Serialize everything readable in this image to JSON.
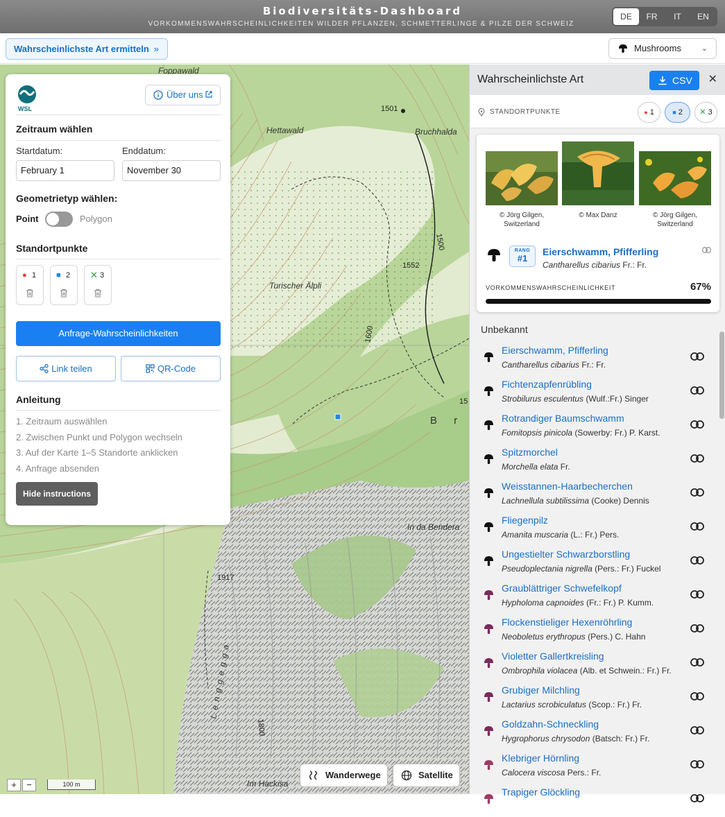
{
  "header": {
    "title": "Biodiversitäts-Dashboard",
    "subtitle": "VORKOMMENSWAHRSCHEINLICHKEITEN WILDER PFLANZEN, SCHMETTERLINGE & PILZE DER SCHWEIZ",
    "languages": [
      "DE",
      "FR",
      "IT",
      "EN"
    ],
    "active_language": "DE"
  },
  "toolbar": {
    "find_species_label": "Wahrscheinlichste Art ermitteln",
    "taxon_select_value": "Mushrooms",
    "taxon_icon": "mushroom-icon"
  },
  "map": {
    "labels": [
      "Foppawald",
      "Hettawald",
      "Bruchhalda",
      "Turischer Älpli",
      "In da Bendera",
      "Lenggegga",
      "Im Hackisa"
    ],
    "elevations": [
      "1501",
      "1552",
      "1500",
      "1600",
      "1917",
      "1800",
      "15"
    ],
    "letters": "B r",
    "scale_label": "100 m",
    "zoom_in": "+",
    "zoom_out": "−",
    "hiking_label": "Wanderwege",
    "satellite_label": "Satellite"
  },
  "control_panel": {
    "about_label": "Über uns",
    "timeframe_heading": "Zeitraum wählen",
    "start_label": "Startdatum:",
    "start_value": "February 1",
    "end_label": "Enddatum:",
    "end_value": "November 30",
    "geometry_heading": "Geometrietyp wählen:",
    "geometry_point": "Point",
    "geometry_polygon": "Polygon",
    "points_heading": "Standortpunkte",
    "points": [
      {
        "n": "1",
        "marker": "●",
        "color": "#e53935"
      },
      {
        "n": "2",
        "marker": "■",
        "color": "#1e88e5"
      },
      {
        "n": "3",
        "marker": "✕",
        "color": "#2e9d3a"
      }
    ],
    "query_label": "Anfrage-Wahrscheinlichkeiten",
    "share_label": "Link teilen",
    "qr_label": "QR-Code",
    "instructions_heading": "Anleitung",
    "steps": [
      "1. Zeitraum auswählen",
      "2. Zwischen Punkt und Polygon wechseln",
      "3. Auf der Karte 1–5 Standorte anklicken",
      "4. Anfrage absenden"
    ],
    "hide_label": "Hide instructions"
  },
  "result_panel": {
    "title": "Wahrscheinlichste Art",
    "csv_label": "CSV",
    "points_label": "STANDORTPUNKTE",
    "point_chips": [
      "1",
      "2",
      "3"
    ],
    "active_chip": "2",
    "photo_credits": [
      "© Jörg Gilgen, Switzerland",
      "© Max Danz",
      "© Jörg Gilgen, Switzerland"
    ],
    "top": {
      "rank_label": "RANG",
      "rank_value": "#1",
      "name": "Eierschwamm, Pfifferling",
      "scientific": "Cantharellus cibarius Fr.: Fr.",
      "prob_label": "VORKOMMENSWAHRSCHEINLICHKEIT",
      "prob_value": "67%",
      "prob_fraction": 0.67
    },
    "unknown_label": "Unbekannt",
    "species": [
      {
        "name": "Eierschwamm, Pfifferling",
        "genus": "Cantharellus cibarius",
        "author": " Fr.: Fr.",
        "color": "#111111"
      },
      {
        "name": "Fichtenzapfenrübling",
        "genus": "Strobilurus esculentus",
        "author": " (Wulf.:Fr.) Singer",
        "color": "#111111"
      },
      {
        "name": "Rotrandiger Baumschwamm",
        "genus": "Fomitopsis pinicola",
        "author": " (Sowerby: Fr.) P. Karst.",
        "color": "#111111"
      },
      {
        "name": "Spitzmorchel",
        "genus": "Morchella elata",
        "author": " Fr.",
        "color": "#111111"
      },
      {
        "name": "Weisstannen-Haarbecherchen",
        "genus": "Lachnellula subtilissima",
        "author": " (Cooke) Dennis",
        "color": "#111111"
      },
      {
        "name": "Fliegenpilz",
        "genus": "Amanita muscaria",
        "author": " (L.: Fr.) Pers.",
        "color": "#111111"
      },
      {
        "name": "Ungestielter Schwarzborstling",
        "genus": "Pseudoplectania nigrella",
        "author": " (Pers.: Fr.) Fuckel",
        "color": "#111111"
      },
      {
        "name": "Graublättriger Schwefelkopf",
        "genus": "Hypholoma capnoides",
        "author": " (Fr.: Fr.) P. Kumm.",
        "color": "#7a2a5c"
      },
      {
        "name": "Flockenstieliger Hexenröhrling",
        "genus": "Neoboletus erythropus",
        "author": " (Pers.) C. Hahn",
        "color": "#7a2a5c"
      },
      {
        "name": "Violetter Gallertkreisling",
        "genus": "Ombrophila violacea",
        "author": " (Alb. et Schwein.: Fr.) Fr.",
        "color": "#7a2a5c"
      },
      {
        "name": "Grubiger Milchling",
        "genus": "Lactarius scrobiculatus",
        "author": " (Scop.: Fr.) Fr.",
        "color": "#7a2a5c"
      },
      {
        "name": "Goldzahn-Schneckling",
        "genus": "Hygrophorus chrysodon",
        "author": " (Batsch: Fr.) Fr.",
        "color": "#7a2a5c"
      },
      {
        "name": "Klebriger Hörnling",
        "genus": "Calocera viscosa",
        "author": " Pers.: Fr.",
        "color": "#a03a66"
      },
      {
        "name": "Trapiger Glöckling",
        "genus": "",
        "author": "",
        "color": "#a03a66"
      }
    ]
  }
}
